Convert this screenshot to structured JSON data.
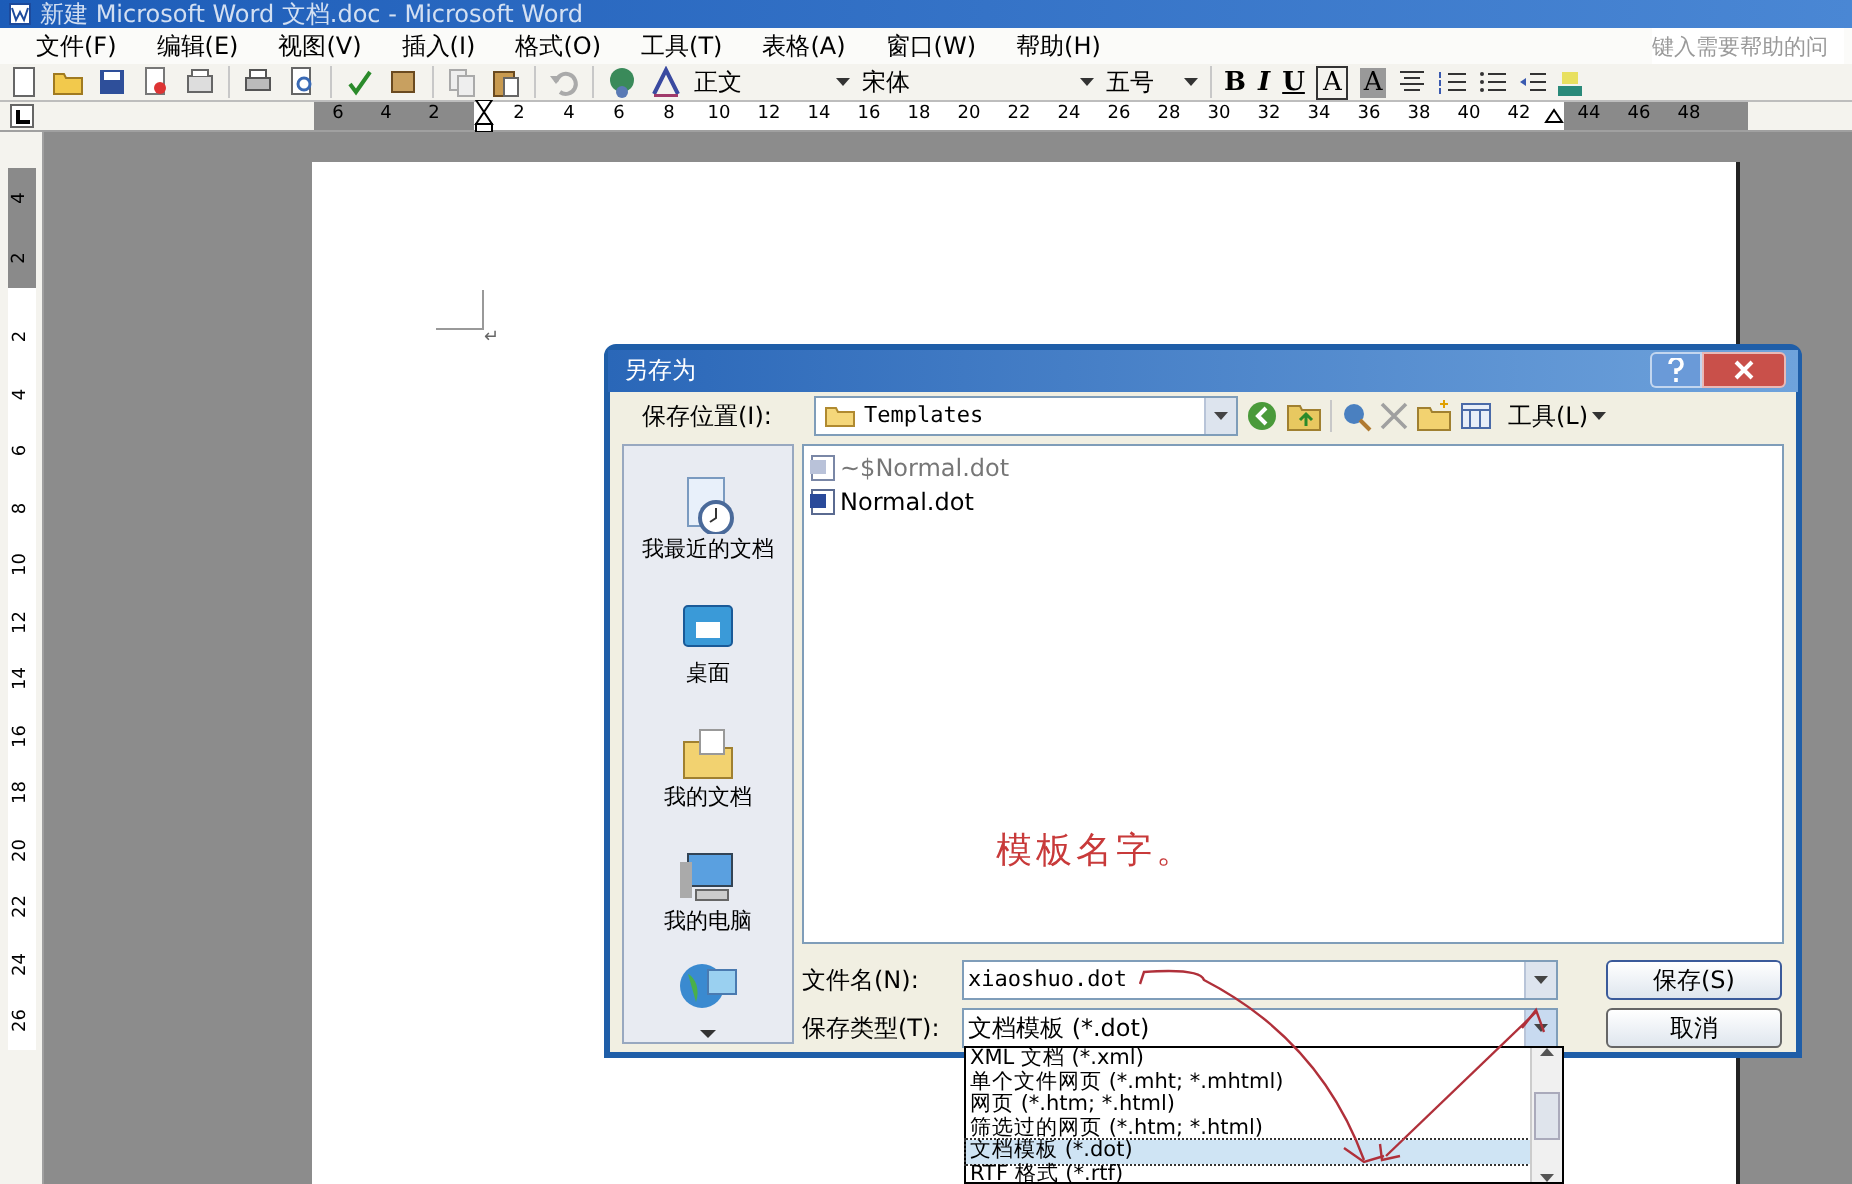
{
  "window": {
    "title": "新建 Microsoft Word 文档.doc - Microsoft Word"
  },
  "menu": [
    "文件(F)",
    "编辑(E)",
    "视图(V)",
    "插入(I)",
    "格式(O)",
    "工具(T)",
    "表格(A)",
    "窗口(W)",
    "帮助(H)"
  ],
  "help_box": {
    "placeholder": "键入需要帮助的问"
  },
  "toolbar": {
    "style": "正文",
    "font": "宋体",
    "size": "五号",
    "format_buttons": [
      "B",
      "I",
      "U",
      "A",
      "A"
    ]
  },
  "ruler": {
    "left_numbers": [
      "6",
      "4",
      "2"
    ],
    "numbers": [
      "2",
      "4",
      "6",
      "8",
      "10",
      "12",
      "14",
      "16",
      "18",
      "20",
      "22",
      "24",
      "26",
      "28",
      "30",
      "32",
      "34",
      "36",
      "38",
      "40",
      "42"
    ],
    "right_numbers": [
      "44",
      "46",
      "48"
    ]
  },
  "vertical_ruler": {
    "top_numbers": [
      "4",
      "2"
    ],
    "numbers": [
      "2",
      "4",
      "6",
      "8",
      "10",
      "12",
      "14",
      "16",
      "18",
      "20",
      "22",
      "24",
      "26"
    ]
  },
  "document": {
    "paragraph_mark": "↵"
  },
  "dialog": {
    "title": "另存为",
    "location_label": "保存位置(I):",
    "location": "Templates",
    "tools_menu": "工具(L)",
    "places": [
      {
        "label": "我最近的文档",
        "kind": "recent"
      },
      {
        "label": "桌面",
        "kind": "desktop"
      },
      {
        "label": "我的文档",
        "kind": "documents"
      },
      {
        "label": "我的电脑",
        "kind": "computer"
      },
      {
        "kind": "network"
      }
    ],
    "files": [
      {
        "name": "~$Normal.dot",
        "hidden": true
      },
      {
        "name": "Normal.dot",
        "hidden": false
      }
    ],
    "annotation": "模板名字。",
    "filename_label": "文件名(N):",
    "filename": "xiaoshuo.dot",
    "filetype_label": "保存类型(T):",
    "filetype": "文档模板 (*.dot)",
    "save_button": "保存(S)",
    "cancel_button": "取消",
    "filetype_options": [
      {
        "label": "XML 文档 (*.xml)",
        "selected": false
      },
      {
        "label": "单个文件网页 (*.mht; *.mhtml)",
        "selected": false
      },
      {
        "label": "网页 (*.htm; *.html)",
        "selected": false
      },
      {
        "label": "筛选过的网页 (*.htm; *.html)",
        "selected": false
      },
      {
        "label": "文档模板 (*.dot)",
        "selected": true
      },
      {
        "label": "RTF 格式 (*.rtf)",
        "selected": false
      }
    ]
  }
}
